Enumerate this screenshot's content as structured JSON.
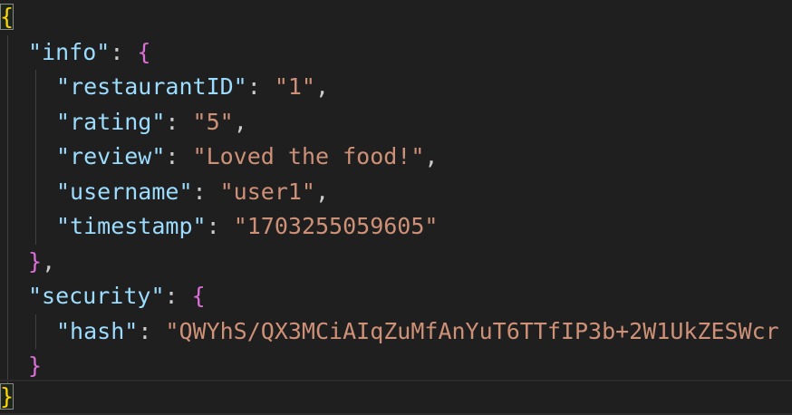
{
  "editor": {
    "language": "json",
    "colors": {
      "background": "#1f1f1f",
      "key": "#9cdcfe",
      "string": "#ce9178",
      "brace_level1": "#ffd700",
      "brace_level2": "#da70d6",
      "punctuation": "#cccccc"
    },
    "lines": [
      {
        "tokens": [
          {
            "text": "{",
            "type": "brace-1",
            "matched": true
          }
        ]
      },
      {
        "tokens": [
          {
            "text": "\"info\"",
            "type": "key"
          },
          {
            "text": ": ",
            "type": "punct"
          },
          {
            "text": "{",
            "type": "brace-2"
          }
        ]
      },
      {
        "tokens": [
          {
            "text": "\"restaurantID\"",
            "type": "key"
          },
          {
            "text": ": ",
            "type": "punct"
          },
          {
            "text": "\"1\"",
            "type": "str"
          },
          {
            "text": ",",
            "type": "punct"
          }
        ]
      },
      {
        "tokens": [
          {
            "text": "\"rating\"",
            "type": "key"
          },
          {
            "text": ": ",
            "type": "punct"
          },
          {
            "text": "\"5\"",
            "type": "str"
          },
          {
            "text": ",",
            "type": "punct"
          }
        ]
      },
      {
        "tokens": [
          {
            "text": "\"review\"",
            "type": "key"
          },
          {
            "text": ": ",
            "type": "punct"
          },
          {
            "text": "\"Loved the food!\"",
            "type": "str"
          },
          {
            "text": ",",
            "type": "punct"
          }
        ]
      },
      {
        "tokens": [
          {
            "text": "\"username\"",
            "type": "key"
          },
          {
            "text": ": ",
            "type": "punct"
          },
          {
            "text": "\"user1\"",
            "type": "str"
          },
          {
            "text": ",",
            "type": "punct"
          }
        ]
      },
      {
        "tokens": [
          {
            "text": "\"timestamp\"",
            "type": "key"
          },
          {
            "text": ": ",
            "type": "punct"
          },
          {
            "text": "\"1703255059605\"",
            "type": "str"
          }
        ]
      },
      {
        "tokens": [
          {
            "text": "}",
            "type": "brace-2"
          },
          {
            "text": ",",
            "type": "punct"
          }
        ]
      },
      {
        "tokens": [
          {
            "text": "\"security\"",
            "type": "key"
          },
          {
            "text": ": ",
            "type": "punct"
          },
          {
            "text": "{",
            "type": "brace-2"
          }
        ]
      },
      {
        "tokens": [
          {
            "text": "\"hash\"",
            "type": "key"
          },
          {
            "text": ": ",
            "type": "punct"
          },
          {
            "text": "\"QWYhS/QX3MCiAIqZuMfAnYuT6TTfIP3b+2W1UkZESWcr",
            "type": "str"
          }
        ]
      },
      {
        "tokens": [
          {
            "text": "}",
            "type": "brace-2"
          }
        ]
      },
      {
        "tokens": [
          {
            "text": "}",
            "type": "brace-1",
            "matched": true
          }
        ]
      }
    ]
  }
}
